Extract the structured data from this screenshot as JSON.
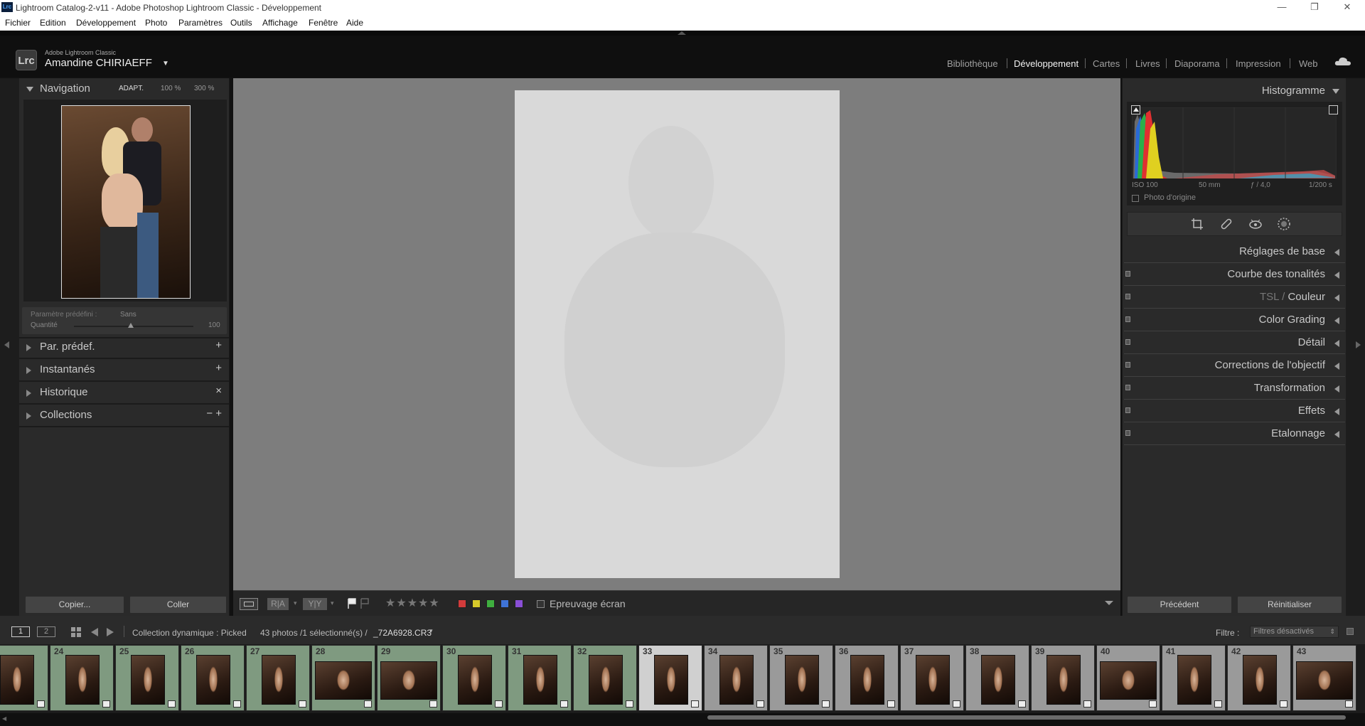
{
  "window": {
    "title": "Lightroom Catalog-2-v11 - Adobe Photoshop Lightroom Classic - Développement",
    "app_badge": "Lrc",
    "controls": [
      "—",
      "❐",
      "✕"
    ]
  },
  "menu": [
    "Fichier",
    "Edition",
    "Développement",
    "Photo",
    "Paramètres",
    "Outils",
    "Affichage",
    "Fenêtre",
    "Aide"
  ],
  "identity": {
    "subtitle": "Adobe Lightroom Classic",
    "user": "Amandine CHIRIAEFF",
    "caret": "▼"
  },
  "modules": [
    {
      "label": "Bibliothèque",
      "active": false
    },
    {
      "label": "Développement",
      "active": true
    },
    {
      "label": "Cartes",
      "active": false
    },
    {
      "label": "Livres",
      "active": false
    },
    {
      "label": "Diaporama",
      "active": false
    },
    {
      "label": "Impression",
      "active": false
    },
    {
      "label": "Web",
      "active": false
    }
  ],
  "navigator": {
    "title": "Navigation",
    "zoom": [
      "ADAPT.",
      "100 %",
      "300 %"
    ]
  },
  "preset": {
    "label": "Paramètre prédéfini :",
    "value": "Sans",
    "amount_label": "Quantité",
    "amount_value": "100",
    "amount_fraction": 0.5
  },
  "left_sections": [
    {
      "label": "Par. prédef.",
      "action": "+"
    },
    {
      "label": "Instantanés",
      "action": "+"
    },
    {
      "label": "Historique",
      "action": "×"
    },
    {
      "label": "Collections",
      "action": "− +"
    }
  ],
  "left_buttons": {
    "copy": "Copier...",
    "paste": "Coller"
  },
  "toolbar": {
    "ra": "R|A",
    "yy": "Y|Y",
    "stars": "★★★★★",
    "label_colors": [
      "#d23b3b",
      "#d6c92a",
      "#3fae3f",
      "#3f73d6",
      "#8a4fd6"
    ],
    "softproof": "Epreuvage écran"
  },
  "histogram": {
    "title": "Histogramme",
    "iso": "ISO 100",
    "focal": "50 mm",
    "aperture": "ƒ / 4,0",
    "shutter": "1/200 s",
    "original": "Photo d'origine"
  },
  "right_sections": [
    {
      "label": "Réglages de base",
      "switch": false
    },
    {
      "label": "Courbe des tonalités",
      "switch": true
    },
    {
      "label": "Couleur",
      "prefix": "TSL / ",
      "switch": true
    },
    {
      "label": "Color Grading",
      "switch": true
    },
    {
      "label": "Détail",
      "switch": true
    },
    {
      "label": "Corrections de l'objectif",
      "switch": true
    },
    {
      "label": "Transformation",
      "switch": true
    },
    {
      "label": "Effets",
      "switch": true
    },
    {
      "label": "Etalonnage",
      "switch": true
    }
  ],
  "right_buttons": {
    "previous": "Précédent",
    "reset": "Réinitialiser"
  },
  "filmstrip": {
    "view1": "1",
    "view2": "2",
    "source": "Collection dynamique : Picked",
    "count": "43 photos /1 sélectionné(s) /",
    "filename": "_72A6928.CR3",
    "filter_label": "Filtre :",
    "filter_value": "Filtres désactivés",
    "thumbs": [
      {
        "num": "",
        "state": "picked",
        "orient": "portrait"
      },
      {
        "num": "24",
        "state": "picked",
        "orient": "portrait"
      },
      {
        "num": "25",
        "state": "picked",
        "orient": "portrait"
      },
      {
        "num": "26",
        "state": "picked",
        "orient": "portrait"
      },
      {
        "num": "27",
        "state": "picked",
        "orient": "portrait"
      },
      {
        "num": "28",
        "state": "picked",
        "orient": "landscape"
      },
      {
        "num": "29",
        "state": "picked",
        "orient": "landscape"
      },
      {
        "num": "30",
        "state": "picked",
        "orient": "portrait"
      },
      {
        "num": "31",
        "state": "picked",
        "orient": "portrait"
      },
      {
        "num": "32",
        "state": "picked",
        "orient": "portrait"
      },
      {
        "num": "33",
        "state": "sel",
        "orient": "portrait"
      },
      {
        "num": "34",
        "state": "normal",
        "orient": "portrait"
      },
      {
        "num": "35",
        "state": "normal",
        "orient": "portrait"
      },
      {
        "num": "36",
        "state": "normal",
        "orient": "portrait"
      },
      {
        "num": "37",
        "state": "normal",
        "orient": "portrait"
      },
      {
        "num": "38",
        "state": "normal",
        "orient": "portrait"
      },
      {
        "num": "39",
        "state": "normal",
        "orient": "portrait"
      },
      {
        "num": "40",
        "state": "normal",
        "orient": "landscape"
      },
      {
        "num": "41",
        "state": "normal",
        "orient": "portrait"
      },
      {
        "num": "42",
        "state": "normal",
        "orient": "portrait"
      },
      {
        "num": "43",
        "state": "normal",
        "orient": "landscape"
      }
    ]
  }
}
